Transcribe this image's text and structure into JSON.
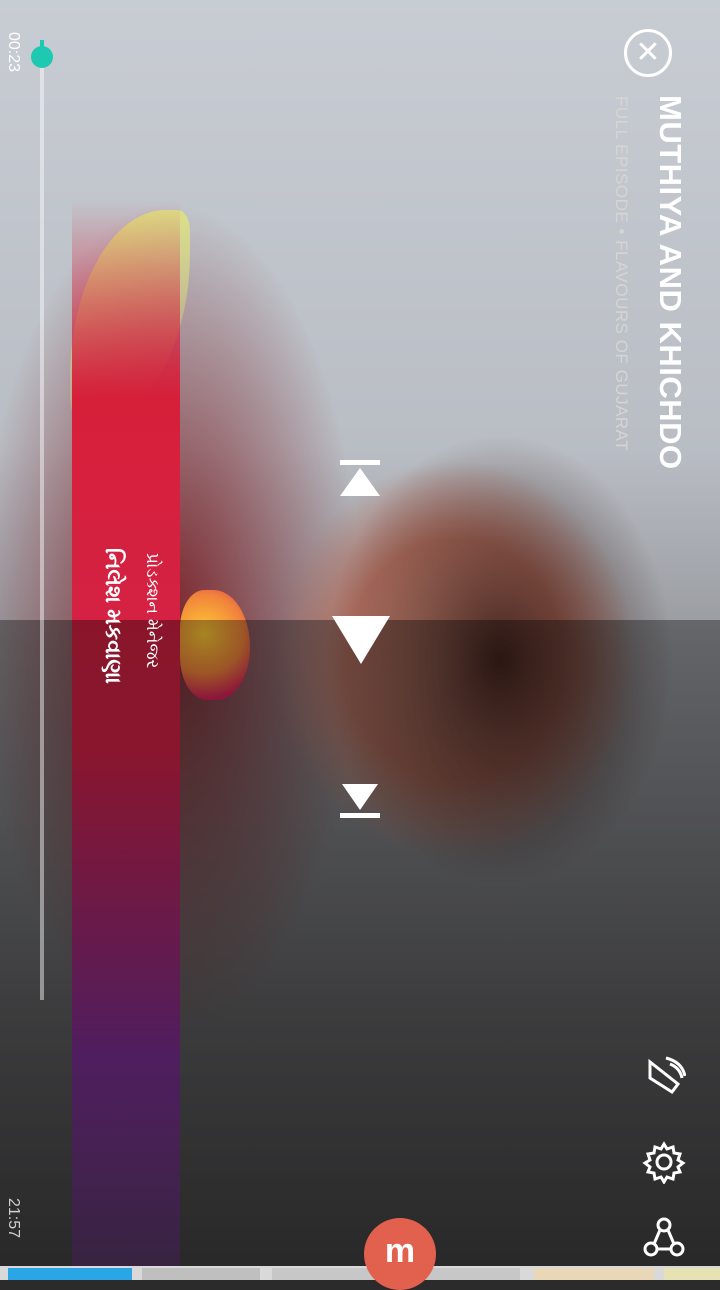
{
  "video": {
    "title": "MUTHIYA AND KHICHDO",
    "subtitle": "FULL EPISODE • FLAVOURS OF GUJARAT",
    "caption_line_1": "પ્રોડક્શન મેનેજર",
    "caption_line_2": "નિલેશ મકવાણા"
  },
  "player": {
    "elapsed_time": "00:23",
    "total_time": "21:57",
    "progress_fraction": 0.018
  },
  "icons": {
    "close": "close-icon",
    "previous": "skip-previous-icon",
    "play": "play-icon",
    "next": "skip-next-icon",
    "cast": "cast-icon",
    "settings": "settings-gear-icon",
    "share": "share-icon"
  },
  "fab": {
    "label": "m"
  },
  "colors": {
    "accent": "#1dc9b0",
    "fab": "#e2604e"
  }
}
